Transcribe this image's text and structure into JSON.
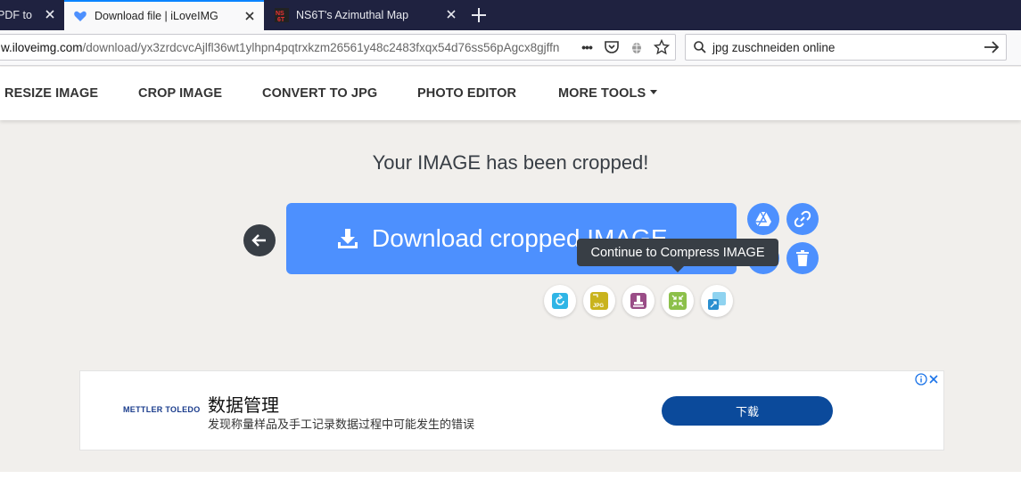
{
  "browser": {
    "tabs": [
      {
        "title": "PDF to P",
        "active": false
      },
      {
        "title": "Download file | iLoveIMG",
        "active": true
      },
      {
        "title": "NS6T's Azimuthal Map",
        "active": false
      }
    ],
    "url_host": "w.iloveimg.com",
    "url_path": "/download/yx3zrdcvcAjlfl36wt1ylhpn4pqtrxkzm26561y48c2483fxqx54d76ss56pAgcx8gjffn",
    "url_more": "•••",
    "search_value": "jpg zuschneiden online"
  },
  "sitenav": {
    "items": [
      "RESIZE IMAGE",
      "CROP IMAGE",
      "CONVERT TO JPG",
      "PHOTO EDITOR",
      "MORE TOOLS"
    ]
  },
  "main": {
    "headline": "Your IMAGE has been cropped!",
    "download_label": "Download cropped IMAGE",
    "tooltip": "Continue to Compress IMAGE"
  },
  "ad": {
    "logo": "METTLER TOLEDO",
    "title": "数据管理",
    "description": "发现称量样品及手工记录数据过程中可能发生的错误",
    "cta": "下载"
  },
  "colors": {
    "accent": "#4d90fe",
    "dark": "#383e45",
    "ad_button": "#0b4a9b",
    "tab_strip": "#1f2240"
  }
}
